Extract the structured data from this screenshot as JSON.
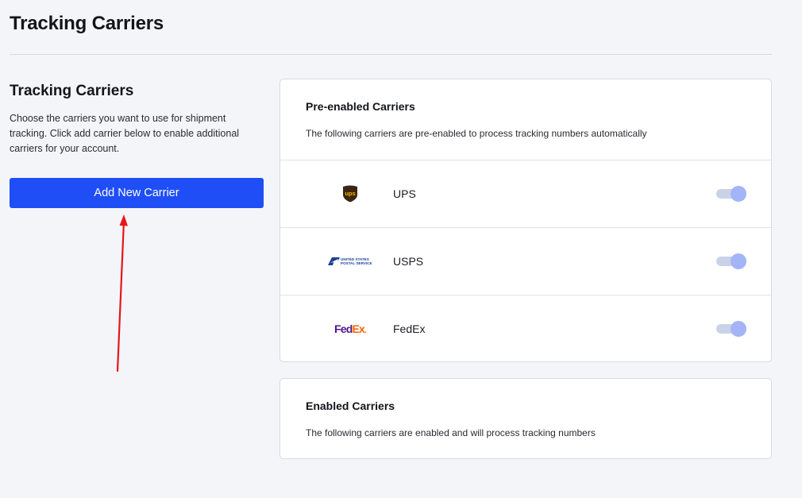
{
  "page": {
    "title": "Tracking Carriers"
  },
  "left": {
    "title": "Tracking Carriers",
    "description": "Choose the carriers you want to use for shipment tracking. Click add carrier below to enable additional carriers for your account.",
    "add_button_label": "Add New Carrier"
  },
  "pre_enabled": {
    "title": "Pre-enabled Carriers",
    "description": "The following carriers are pre-enabled to process tracking numbers automatically",
    "carriers": [
      {
        "name": "UPS",
        "logo": "ups-logo",
        "logo_text": "ups",
        "enabled": true
      },
      {
        "name": "USPS",
        "logo": "usps-logo",
        "logo_text": "UNITED STATES POSTAL SERVICE",
        "enabled": true
      },
      {
        "name": "FedEx",
        "logo": "fedex-logo",
        "logo_text_fed": "Fed",
        "logo_text_ex": "Ex",
        "enabled": true
      }
    ]
  },
  "enabled": {
    "title": "Enabled Carriers",
    "description": "The following carriers are enabled and will process tracking numbers"
  },
  "colors": {
    "primary": "#1f4ef7",
    "toggle_knob": "#a3b4f7",
    "toggle_track": "#c9d2e8",
    "annotation_arrow": "#e8151b",
    "fedex_purple": "#4d148c",
    "fedex_orange": "#ff6200",
    "ups_brown": "#3d2512",
    "ups_gold": "#f7b500"
  }
}
